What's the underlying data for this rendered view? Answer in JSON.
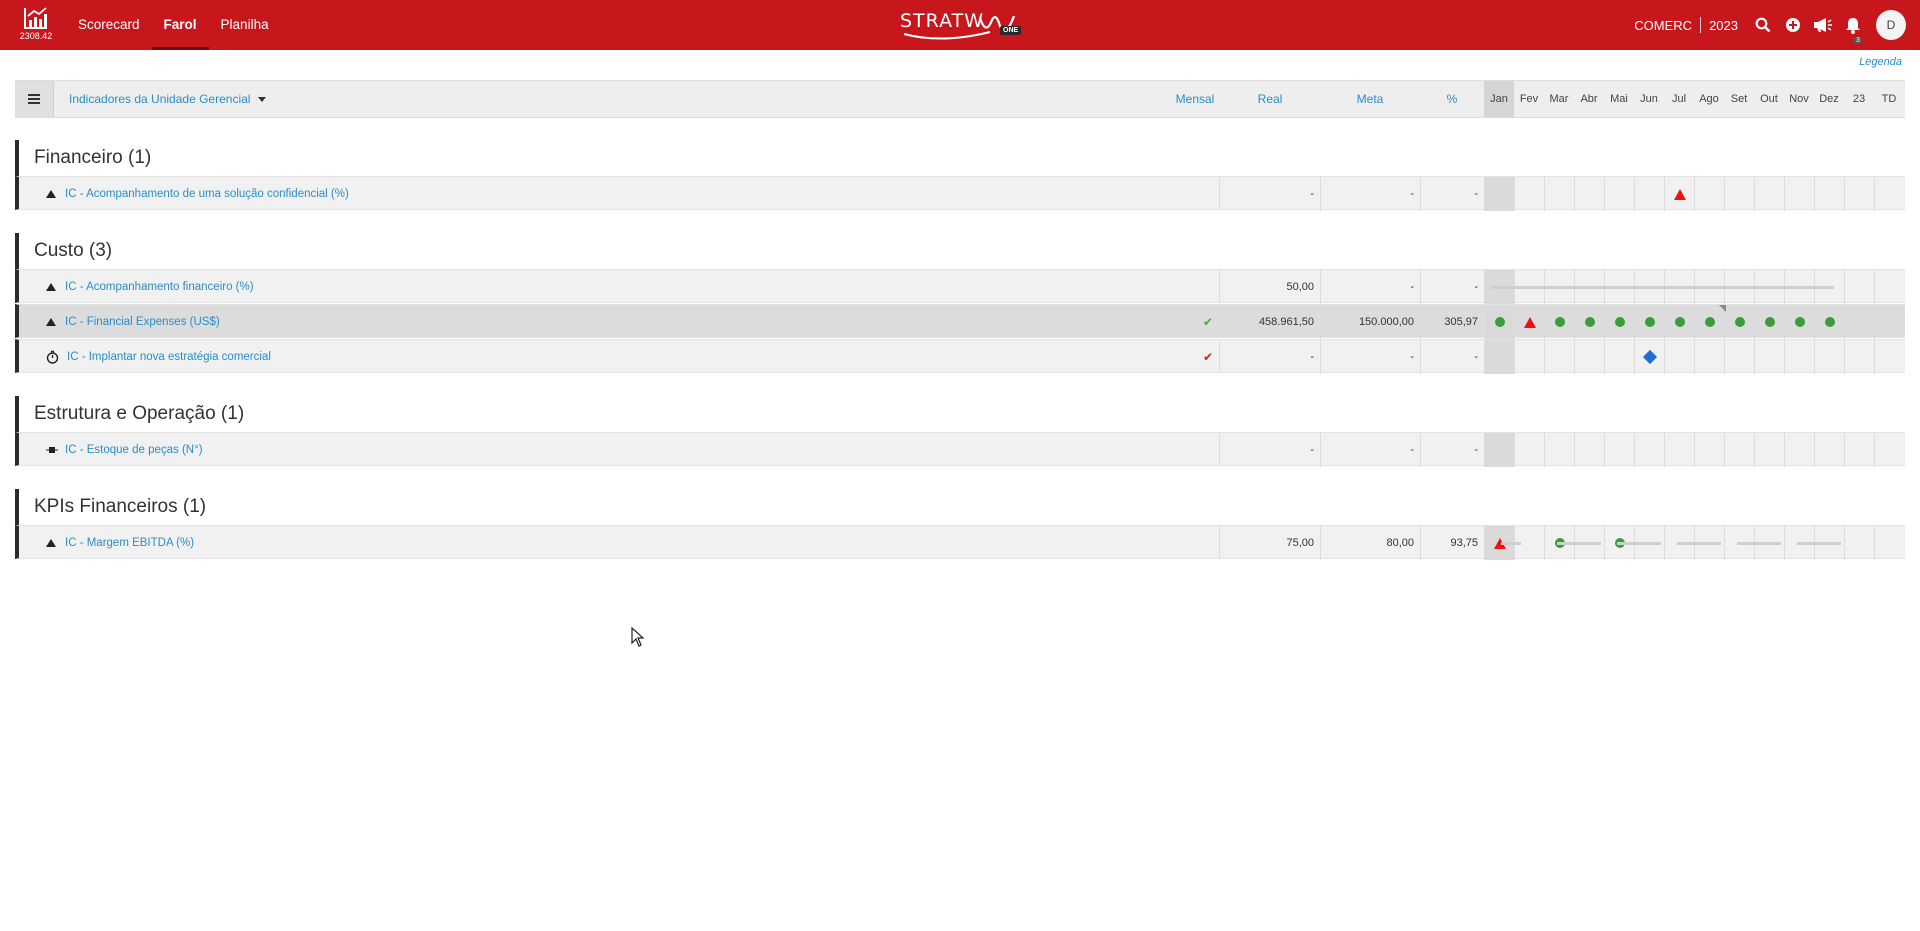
{
  "topbar": {
    "version": "2308.42",
    "nav": [
      {
        "label": "Scorecard",
        "active": false
      },
      {
        "label": "Farol",
        "active": true
      },
      {
        "label": "Planilha",
        "active": false
      }
    ],
    "brand": "STRATW",
    "brand_badge": "ONE",
    "company": "COMERC",
    "year": "2023",
    "notifications_count": "3",
    "avatar_initial": "D",
    "color": "#c8161d"
  },
  "legend_link": "Legenda",
  "header": {
    "dropdown_label": "Indicadores da Unidade Gerencial",
    "period": "Mensal",
    "real": "Real",
    "meta": "Meta",
    "pct": "%",
    "months": [
      "Jan",
      "Fev",
      "Mar",
      "Abr",
      "Mai",
      "Jun",
      "Jul",
      "Ago",
      "Set",
      "Out",
      "Nov",
      "Dez",
      "23",
      "TD"
    ]
  },
  "groups": [
    {
      "title": "Financeiro (1)",
      "rows": [
        {
          "icon": "up-triangle-icon",
          "label": "IC - Acompanhamento de uma solução confidencial (%)",
          "check": "",
          "real": "-",
          "meta": "-",
          "pct": "-",
          "marks": [
            "",
            "",
            "",
            "",
            "",
            "",
            "red-triangle",
            "",
            "",
            "",
            "",
            "",
            "",
            ""
          ]
        }
      ]
    },
    {
      "title": "Custo (3)",
      "rows": [
        {
          "icon": "up-triangle-icon",
          "label": "IC - Acompanhamento financeiro (%)",
          "check": "",
          "real": "50,00",
          "meta": "-",
          "pct": "-",
          "marks": [
            "line",
            "",
            "",
            "",
            "",
            "",
            "",
            "",
            "",
            "",
            "",
            "",
            "",
            ""
          ]
        },
        {
          "icon": "up-triangle-icon",
          "label": "IC - Financial Expenses (US$)",
          "check": "green",
          "real": "458.961,50",
          "meta": "150.000,00",
          "pct": "305,97",
          "marks": [
            "green-dot",
            "red-triangle",
            "green-dot",
            "green-dot",
            "green-dot",
            "green-dot",
            "green-dot",
            "green-dot",
            "green-dot",
            "green-dot",
            "green-dot",
            "green-dot",
            "",
            ""
          ]
        },
        {
          "icon": "stopwatch-icon",
          "label": "IC - Implantar nova estratégia comercial",
          "check": "red",
          "real": "-",
          "meta": "-",
          "pct": "-",
          "marks": [
            "",
            "",
            "",
            "",
            "",
            "blue-diamond",
            "",
            "",
            "",
            "",
            "",
            "",
            "",
            ""
          ]
        }
      ]
    },
    {
      "title": "Estrutura e Operação (1)",
      "rows": [
        {
          "icon": "pin-icon",
          "label": "IC - Estoque de peças (N°)",
          "check": "",
          "real": "-",
          "meta": "-",
          "pct": "-",
          "marks": [
            "",
            "",
            "",
            "",
            "",
            "",
            "",
            "",
            "",
            "",
            "",
            "",
            "",
            ""
          ]
        }
      ]
    },
    {
      "title": "KPIs Financeiros (1)",
      "rows": [
        {
          "icon": "up-triangle-icon",
          "label": "IC - Margem EBITDA (%)",
          "check": "",
          "real": "75,00",
          "meta": "80,00",
          "pct": "93,75",
          "marks": [
            "red-triangle",
            "",
            "green-dot",
            "",
            "green-dot",
            "",
            "",
            "",
            "",
            "",
            "",
            "",
            "",
            ""
          ]
        }
      ]
    }
  ]
}
